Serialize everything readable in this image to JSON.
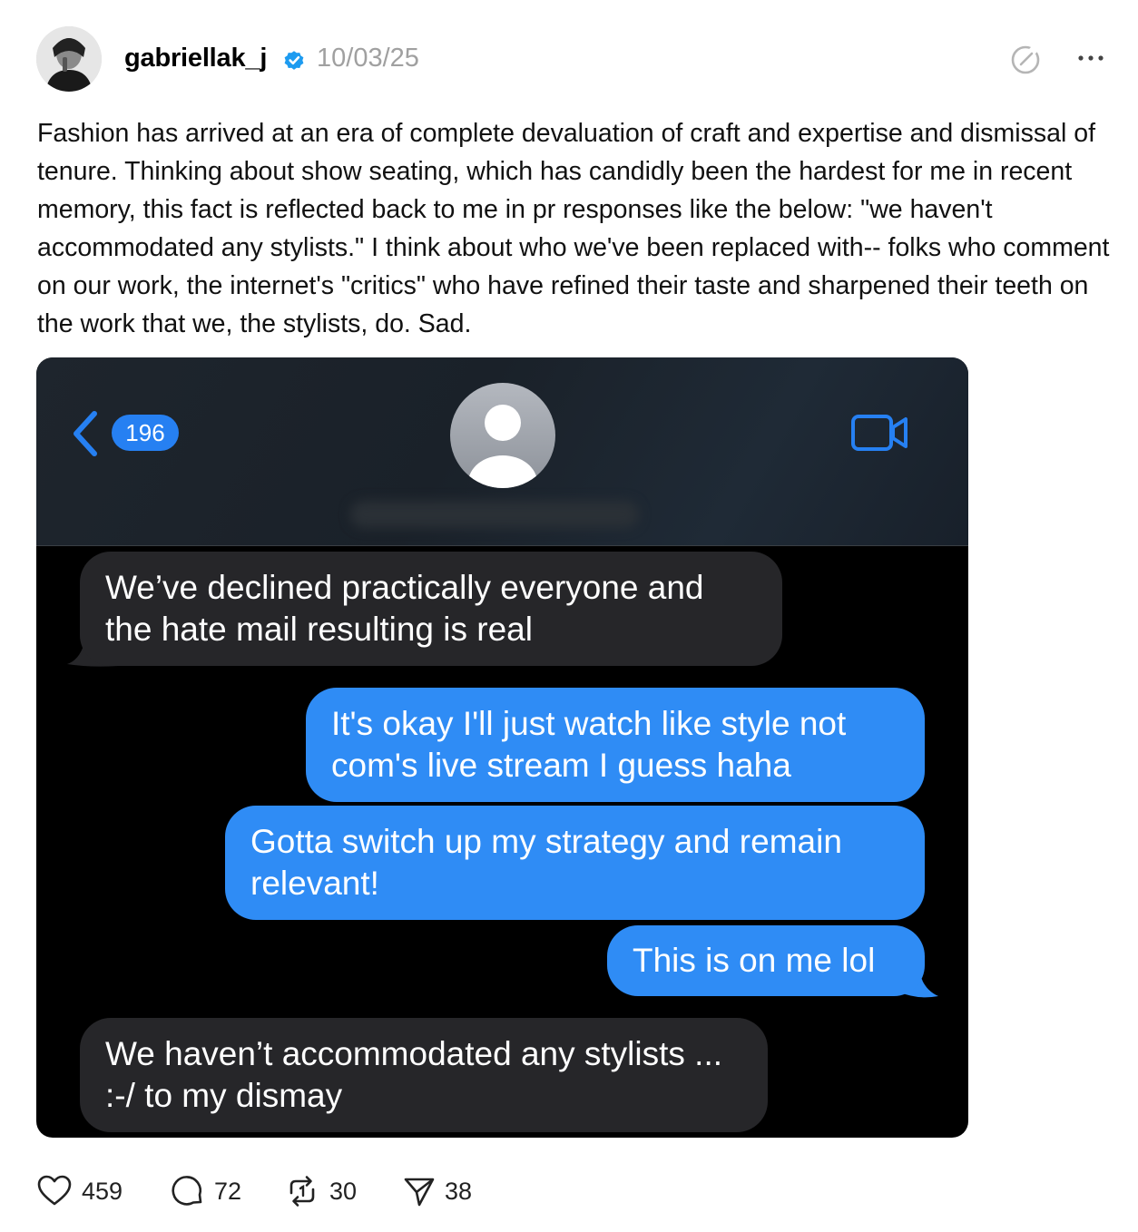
{
  "post": {
    "username": "gabriellak_j",
    "date": "10/03/25",
    "body": "Fashion has arrived at an era of complete devaluation of craft and expertise and dismissal of tenure. Thinking about show seating, which has candidly been the hardest for me in recent memory, this fact is reflected back to me in pr responses like the below: \"we haven't accommodated any stylists.\" I think about who we've been replaced with-- folks who comment on our work, the internet's \"critics\" who have refined their taste and sharpened their teeth on the work that we, the stylists, do. Sad."
  },
  "screenshot": {
    "back_count": "196",
    "messages": [
      {
        "direction": "in",
        "text": "We’ve declined practically everyone and the hate mail resulting is real"
      },
      {
        "direction": "out",
        "text": "It's okay I'll just watch like style not com's live stream I guess haha"
      },
      {
        "direction": "out",
        "text": "Gotta switch up my strategy and remain relevant!"
      },
      {
        "direction": "out",
        "text": "This is on me lol"
      },
      {
        "direction": "in",
        "text": "We haven’t accommodated any stylists ... :-/ to my dismay"
      }
    ]
  },
  "actions": {
    "likes": "459",
    "replies": "72",
    "reposts": "30",
    "shares": "38"
  },
  "colors": {
    "verified": "#1d9bf0",
    "outgoing_bubble": "#2f8cf5",
    "incoming_bubble": "#262629",
    "ios_blue": "#2680f2"
  },
  "icons": [
    "verified-badge-icon",
    "threads-compose-icon",
    "more-options-icon",
    "back-chevron-icon",
    "contact-avatar-icon",
    "video-call-icon",
    "heart-icon",
    "comment-icon",
    "repost-icon",
    "share-icon"
  ]
}
